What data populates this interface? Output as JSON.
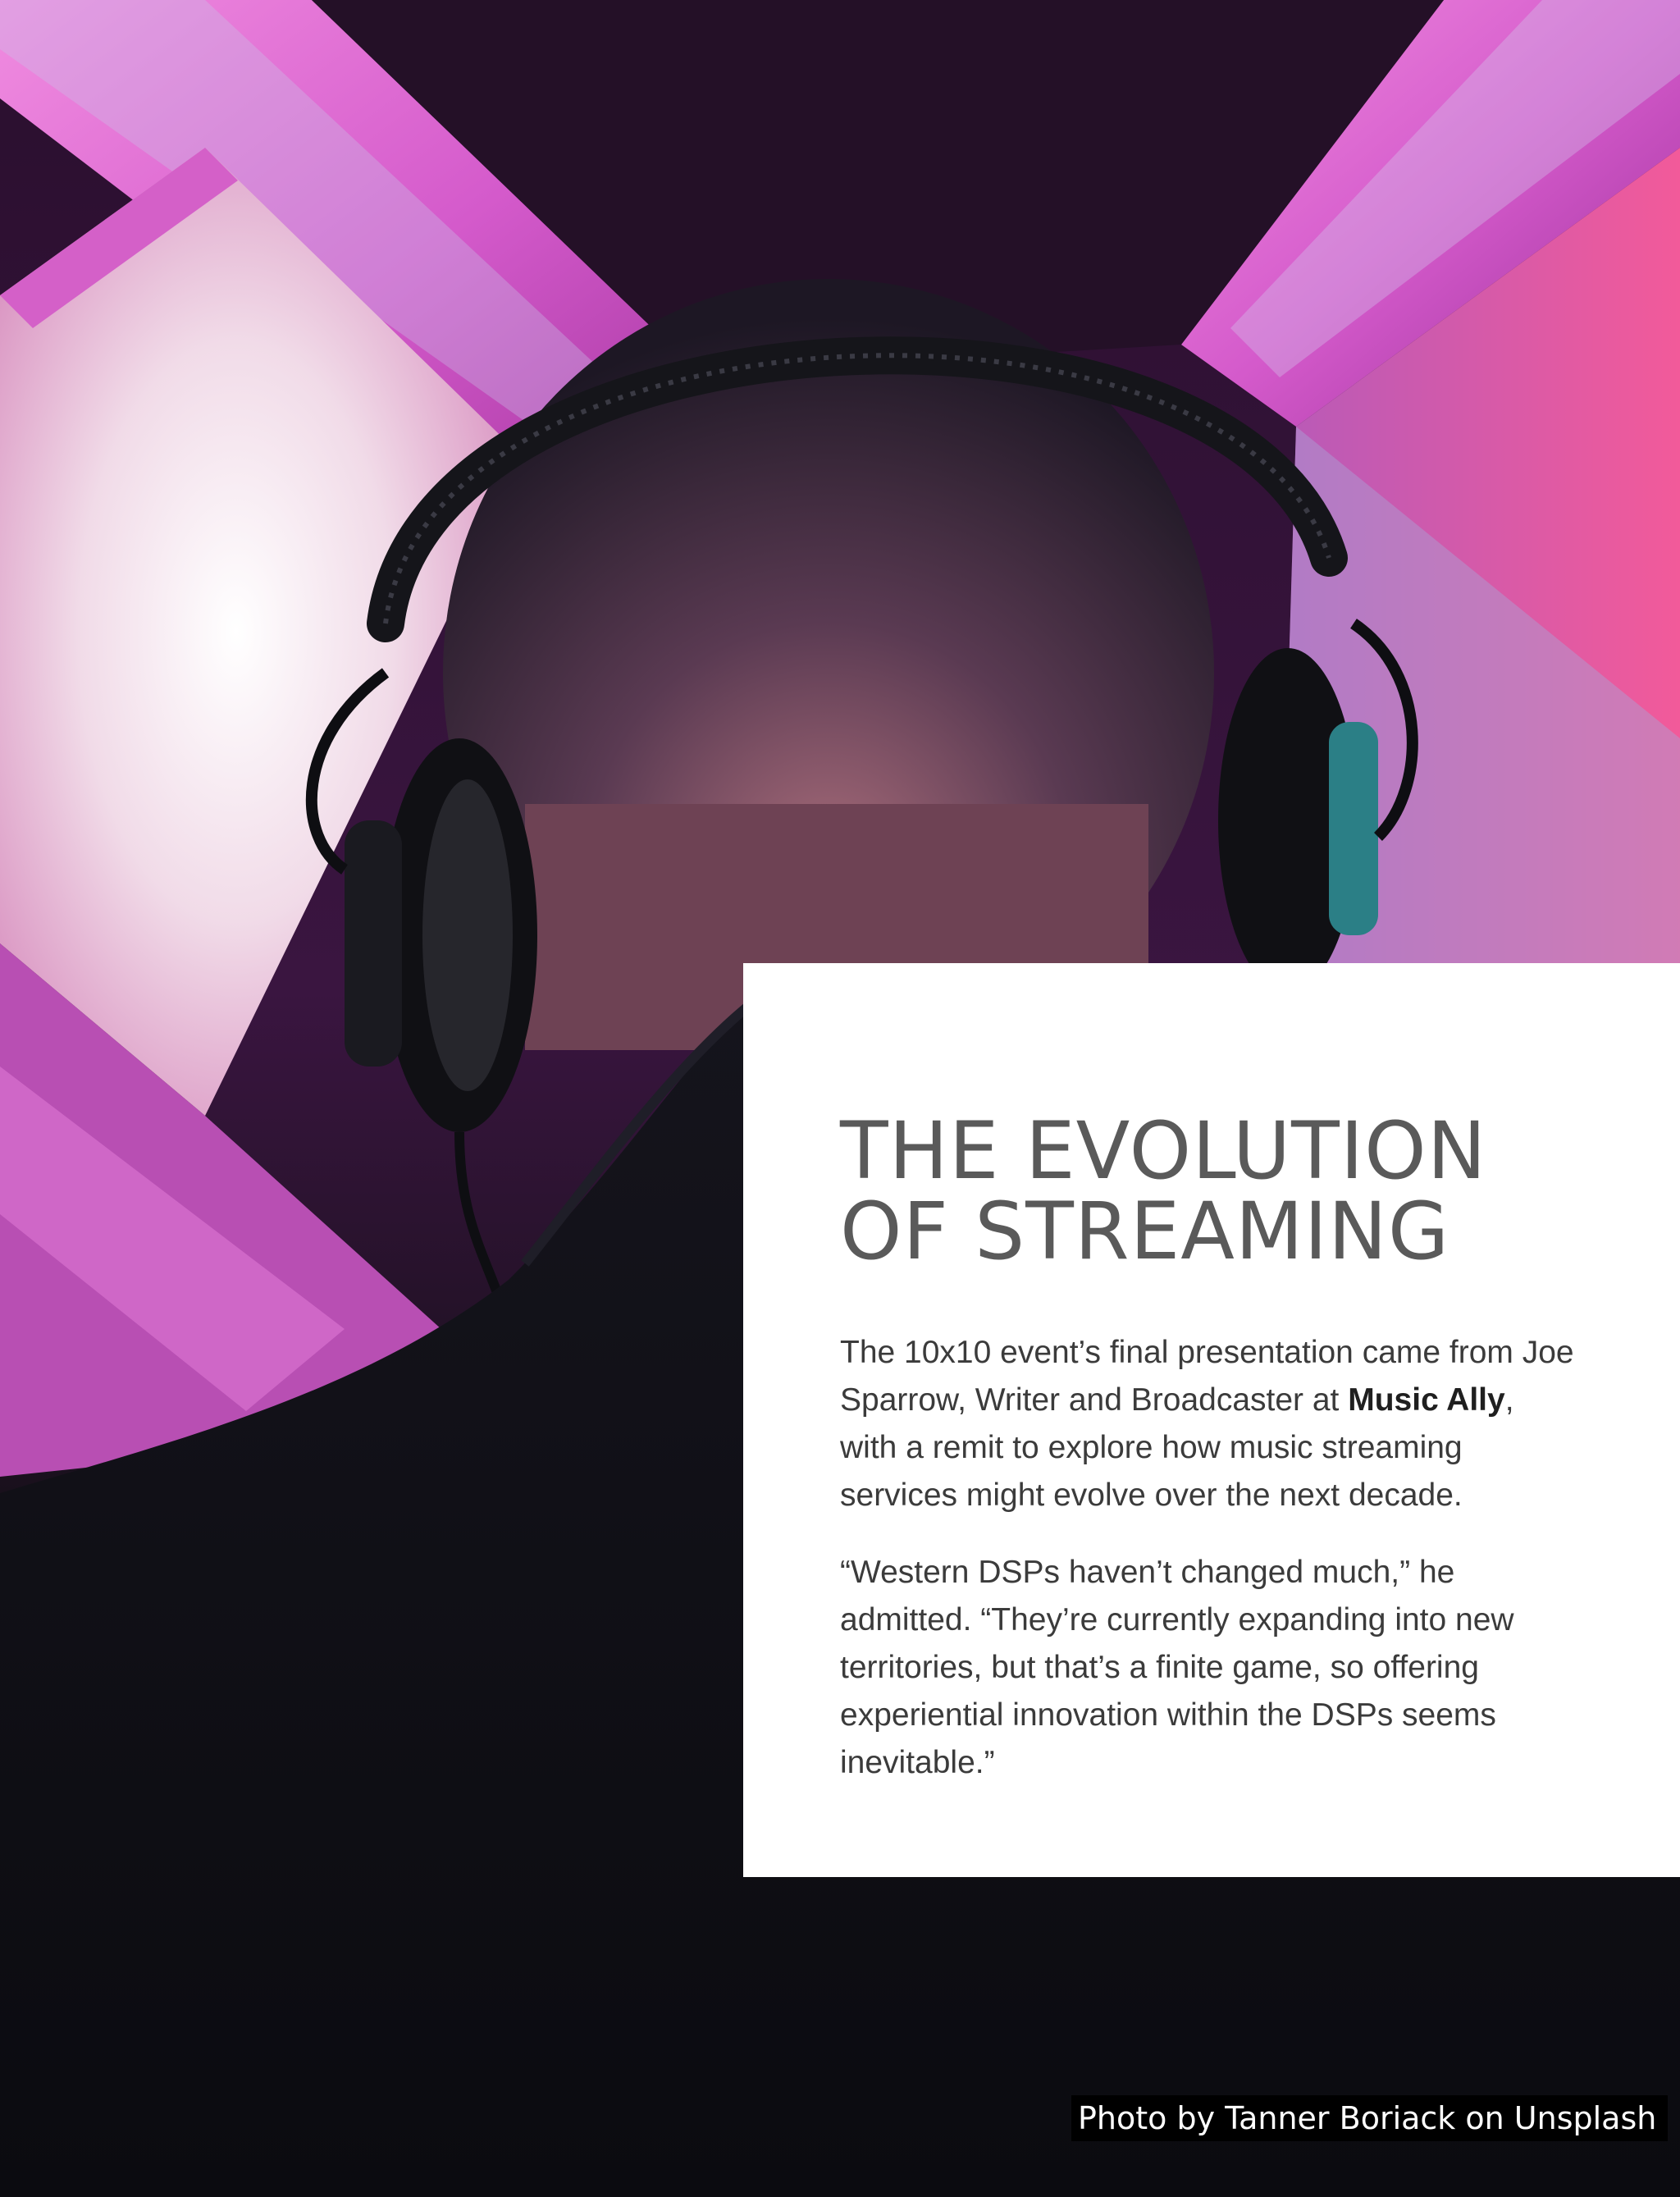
{
  "article": {
    "title": "THE EVOLUTION\nOF STREAMING",
    "paragraph1": {
      "part1": "The 10x10 event’s final presentation came from Joe Sparrow, Writer and Broadcaster at ",
      "bold": "Music Ally",
      "part2": ", with a remit to explore how music streaming services might evolve over the next decade."
    },
    "paragraph2": "“Western DSPs haven’t changed much,” he admitted. “They’re currently expanding into new territories, but that’s a finite game, so offering experiential innovation within the DSPs seems inevitable.”"
  },
  "photo": {
    "credit": "Photo by Tanner Boriack on Unsplash"
  },
  "colors": {
    "background_dark": "#0d0d14",
    "neon_pink": "#e06ad8",
    "neon_magenta": "#c23fb8",
    "card_white": "#ffffff",
    "title_gray": "#5a5a5a",
    "body_gray": "#3b3b3b"
  }
}
